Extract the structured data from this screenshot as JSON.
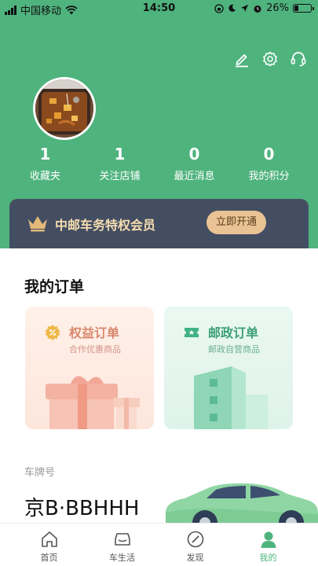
{
  "status_bar": {
    "carrier": "中国移动",
    "time": "14:50",
    "battery": "26%"
  },
  "header": {
    "top_icons": [
      "edit-icon",
      "settings-icon",
      "customer-service-icon"
    ],
    "stats": [
      {
        "value": "1",
        "label": "收藏夹"
      },
      {
        "value": "1",
        "label": "关注店铺"
      },
      {
        "value": "0",
        "label": "最近消息"
      },
      {
        "value": "0",
        "label": "我的积分"
      }
    ]
  },
  "vip": {
    "title": "中邮车务特权会员",
    "button": "立即开通"
  },
  "orders": {
    "title": "我的订单",
    "cards": [
      {
        "title": "权益订单",
        "subtitle": "合作优惠商品"
      },
      {
        "title": "邮政订单",
        "subtitle": "邮政自营商品"
      }
    ]
  },
  "plate": {
    "label": "车牌号",
    "number": "京B·BBHHH"
  },
  "tabs": [
    {
      "label": "首页"
    },
    {
      "label": "车生活"
    },
    {
      "label": "发现"
    },
    {
      "label": "我的"
    }
  ],
  "colors": {
    "primary": "#4fb37e",
    "vip_bg": "#444e62",
    "vip_gold": "#e9c393"
  }
}
